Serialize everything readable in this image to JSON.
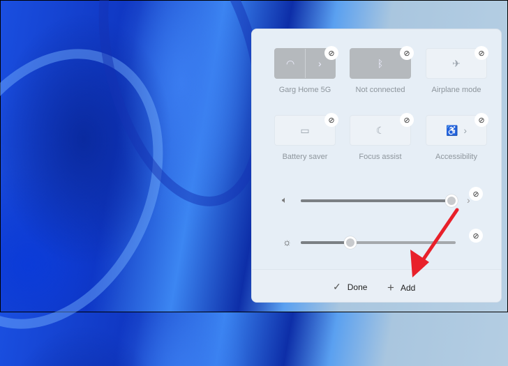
{
  "tiles": [
    {
      "label": "Garg Home 5G",
      "icon": "wifi-icon",
      "active": true,
      "has_chevron": true
    },
    {
      "label": "Not connected",
      "icon": "bluetooth-icon",
      "active": true
    },
    {
      "label": "Airplane mode",
      "icon": "airplane-icon",
      "active": false
    },
    {
      "label": "Battery saver",
      "icon": "battery-saver-icon",
      "active": false
    },
    {
      "label": "Focus assist",
      "icon": "moon-icon",
      "active": false
    },
    {
      "label": "Accessibility",
      "icon": "accessibility-icon",
      "active": false,
      "has_chevron": true
    }
  ],
  "sliders": {
    "volume_percent": 100,
    "brightness_percent": 32
  },
  "footer": {
    "done_label": "Done",
    "add_label": "Add"
  },
  "annotation": {
    "arrow_color": "#e8202a"
  }
}
